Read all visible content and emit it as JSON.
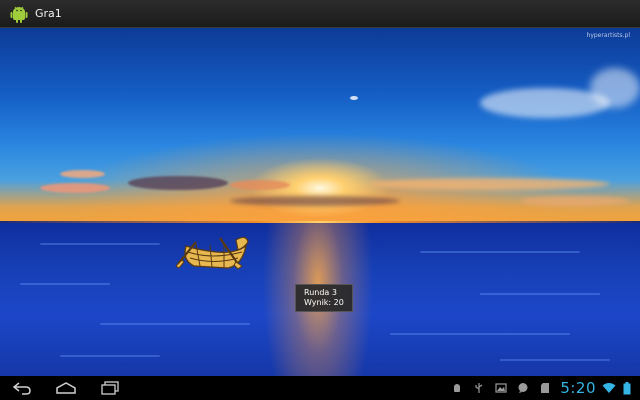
{
  "app": {
    "title": "Gra1",
    "icon": "android-app-icon"
  },
  "scene": {
    "watermark": "hyperartists.pl"
  },
  "game": {
    "round_label": "Runda 3",
    "score_label": "Wynik: 20",
    "sprite": "wooden-boat"
  },
  "navbar": {
    "buttons": [
      "back-icon",
      "home-icon",
      "recent-apps-icon"
    ],
    "status_icons": [
      "android-debug-icon",
      "usb-icon",
      "gallery-icon",
      "chat-icon",
      "sd-card-icon"
    ],
    "time": "5:20",
    "time_color": "#35b5e5"
  }
}
